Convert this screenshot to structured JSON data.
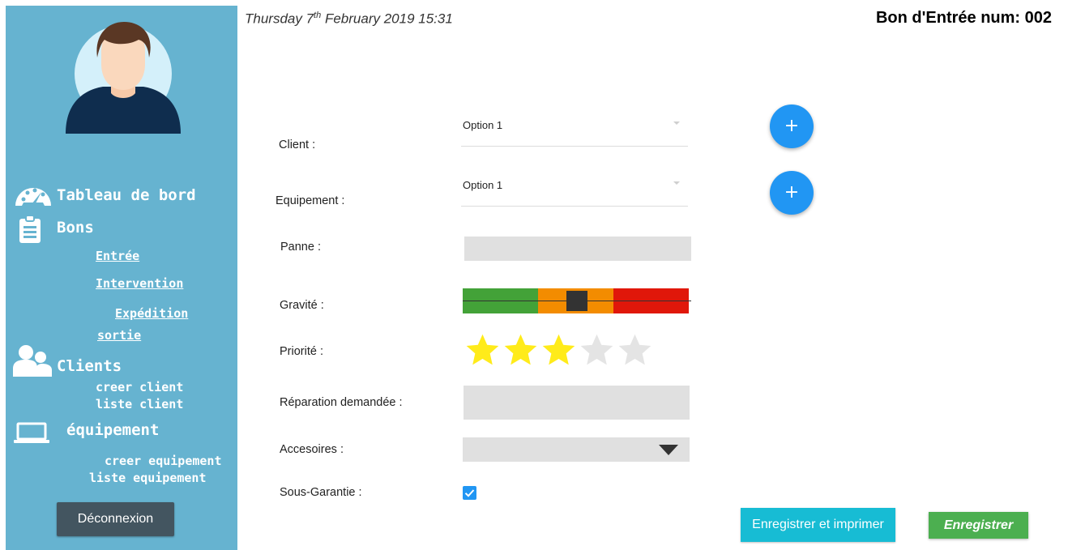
{
  "header": {
    "date_prefix": "Thursday 7",
    "date_suffix": "th",
    "date_rest": " February 2019 15:31",
    "doc_title": "Bon d'Entrée num: 002"
  },
  "sidebar": {
    "dashboard": "Tableau de bord",
    "bons": "Bons",
    "bons_items": [
      "Entrée",
      "Intervention",
      "Expédition",
      "sortie"
    ],
    "clients": "Clients",
    "clients_items": [
      "creer client",
      "liste client"
    ],
    "equipement": "équipement",
    "equipement_items": [
      "creer equipement",
      "liste equipement"
    ],
    "logout": "Déconnexion"
  },
  "form": {
    "client_label": "Client :",
    "client_value": "Option 1",
    "equipement_label": "Equipement :",
    "equipement_value": "Option 1",
    "add_glyph": "+",
    "panne_label": "Panne :",
    "panne_value": "",
    "gravite_label": "Gravité :",
    "gravite_level": 0.5,
    "gravite_colors": [
      "#43a238",
      "#f38c00",
      "#e0170a"
    ],
    "priorite_label": "Priorité :",
    "priorite_stars": 3,
    "priorite_max": 5,
    "star_on_color": "#ffeb1a",
    "star_off_color": "#e4e4e4",
    "reparation_label": "Réparation demandée :",
    "reparation_value": "",
    "accessoires_label": "Accesoires :",
    "garantie_label": "Sous-Garantie :",
    "garantie_checked": true
  },
  "actions": {
    "print_label": "Enregistrer et imprimer",
    "save_label": "Enregistrer"
  }
}
